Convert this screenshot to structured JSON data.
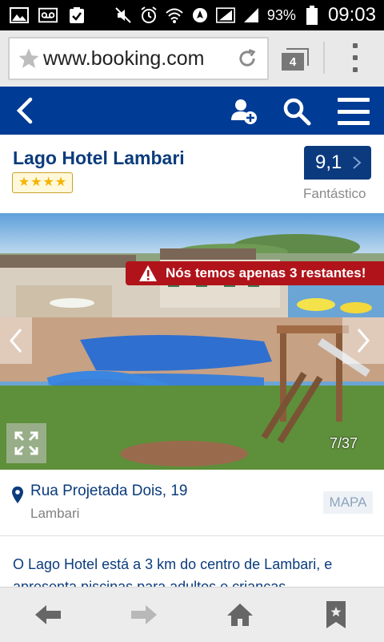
{
  "status_bar": {
    "battery": "93%",
    "time": "09:03",
    "icons": [
      "image-icon",
      "voicemail-icon",
      "clipboard-check-icon",
      "mute-icon",
      "alarm-icon",
      "wifi-icon",
      "signal-icon",
      "battery-icon"
    ]
  },
  "browser": {
    "url": "www.booking.com",
    "tab_count": "4"
  },
  "hotel": {
    "name": "Lago Hotel Lambari",
    "stars": 4,
    "score": "9,1",
    "score_label": "Fantástico"
  },
  "gallery": {
    "alert": "Nós temos apenas 3 restantes!",
    "counter": "7/37"
  },
  "address": {
    "street": "Rua Projetada Dois, 19",
    "city": "Lambari",
    "map_label": "MAPA"
  },
  "description": "O Lago Hotel está a 3 km do centro de Lambari, e apresenta piscinas para adultos e crianças",
  "colors": {
    "brand_blue": "#003b95",
    "alert_red": "#b0141a",
    "star_gold": "#f5b400"
  }
}
